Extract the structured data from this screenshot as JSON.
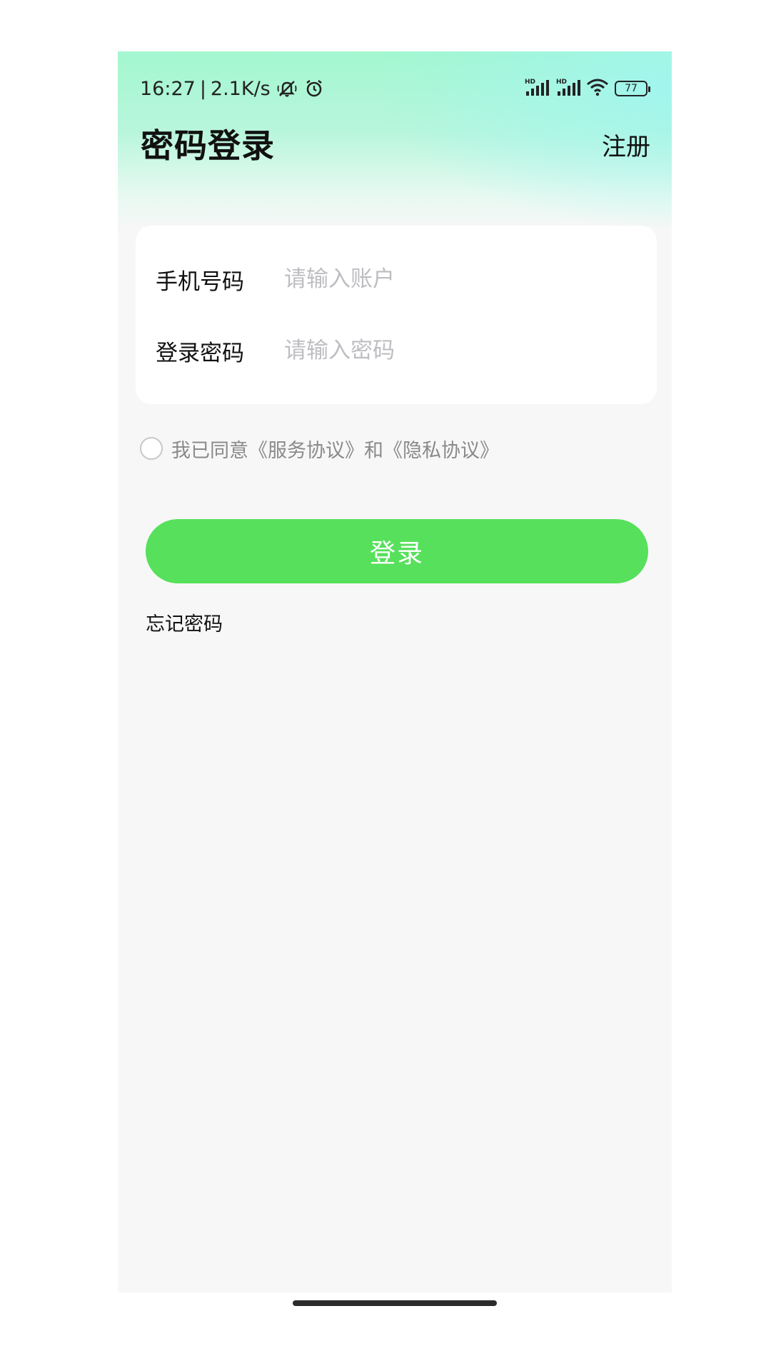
{
  "status_bar": {
    "time": "16:27",
    "separator": "|",
    "net_speed": "2.1K/s",
    "battery_level": "77",
    "icons": [
      "mute-icon",
      "alarm-icon",
      "signal-hd-icon",
      "signal-hd-icon",
      "wifi-icon",
      "battery-icon"
    ]
  },
  "header": {
    "title": "密码登录",
    "register_label": "注册"
  },
  "form": {
    "phone_label": "手机号码",
    "phone_placeholder": "请输入账户",
    "phone_value": "",
    "password_label": "登录密码",
    "password_placeholder": "请输入密码",
    "password_value": ""
  },
  "agreement": {
    "checked": false,
    "text": "我已同意《服务协议》和《隐私协议》"
  },
  "actions": {
    "login_label": "登录",
    "forgot_label": "忘记密码"
  },
  "colors": {
    "accent": "#57e05c",
    "gradient_top": "#a3f7cf",
    "background": "#f7f7f7",
    "placeholder": "#bdbdc2"
  }
}
